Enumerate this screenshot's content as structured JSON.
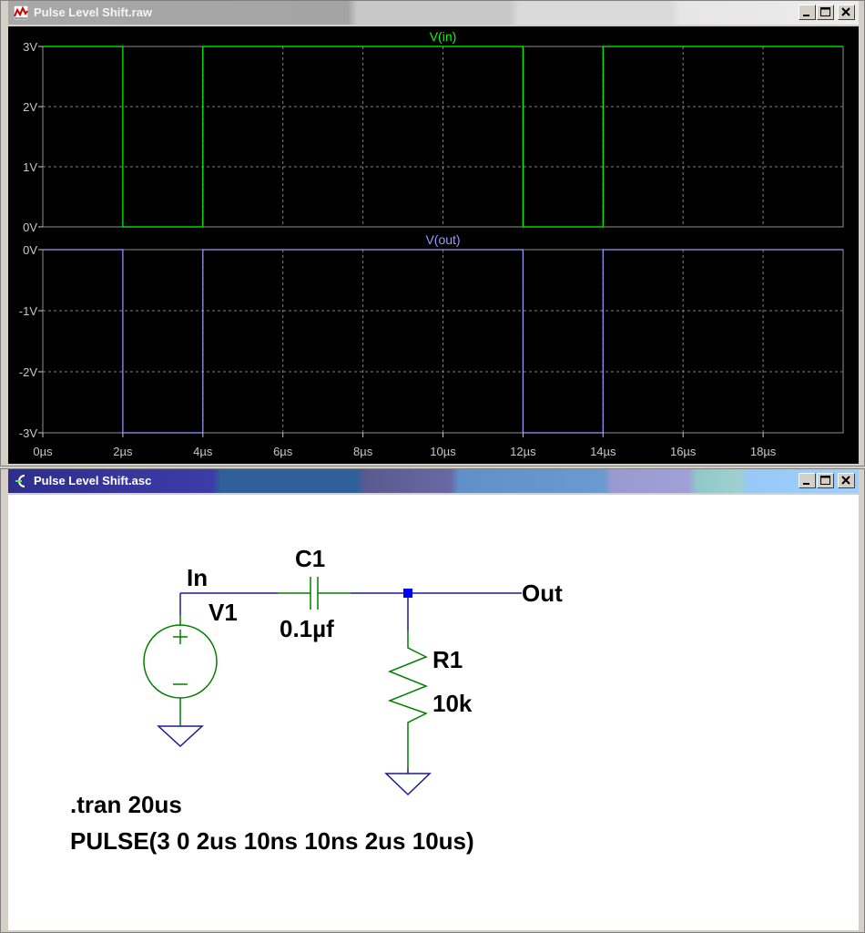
{
  "waveform_window": {
    "title": "Pulse Level Shift.raw",
    "icon": "waveform-icon"
  },
  "schematic_window": {
    "title": "Pulse Level Shift.asc",
    "icon": "schematic-icon"
  },
  "window_controls": [
    "minimize-icon",
    "maximize-icon",
    "close-icon"
  ],
  "colors": {
    "vin_trace": "#00ff00",
    "vout_trace": "#9a9aff",
    "grid": "#808080",
    "wire": "#1a1a8a",
    "component": "#008000",
    "junction": "#0000ff"
  },
  "chart_data": {
    "type": "line",
    "x_ticks": [
      "0µs",
      "2µs",
      "4µs",
      "6µs",
      "8µs",
      "10µs",
      "12µs",
      "14µs",
      "16µs",
      "18µs"
    ],
    "xlim": [
      0,
      20
    ],
    "grid": true,
    "panes": [
      {
        "trace": "V(in)",
        "yticks": [
          "3V",
          "2V",
          "1V",
          "0V"
        ],
        "ytick_values": [
          3,
          2,
          1,
          0
        ],
        "ylim": [
          0,
          3
        ],
        "x": [
          0,
          2,
          2,
          4,
          4,
          12,
          12,
          14,
          14,
          20
        ],
        "y": [
          3,
          3,
          0,
          0,
          3,
          3,
          0,
          0,
          3,
          3
        ]
      },
      {
        "trace": "V(out)",
        "yticks": [
          "0V",
          "-1V",
          "-2V",
          "-3V"
        ],
        "ytick_values": [
          0,
          -1,
          -2,
          -3
        ],
        "ylim": [
          -3,
          0
        ],
        "x": [
          0,
          2,
          2,
          4,
          4,
          12,
          12,
          14,
          14,
          20
        ],
        "y": [
          0,
          0,
          -3,
          -3,
          0,
          0,
          -3,
          -3,
          0,
          0
        ]
      }
    ]
  },
  "schematic": {
    "net_in": "In",
    "net_out": "Out",
    "v1_name": "V1",
    "c1_name": "C1",
    "c1_value": "0.1µf",
    "r1_name": "R1",
    "r1_value": "10k",
    "directive_tran": ".tran 20us",
    "directive_pulse": "PULSE(3 0 2us 10ns 10ns 2us 10us)"
  }
}
